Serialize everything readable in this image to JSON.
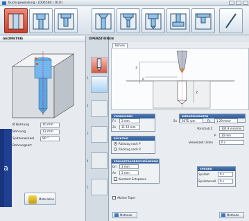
{
  "window": {
    "title": "Buchsgewindung - [D04580 / D10]"
  },
  "toolbar": {
    "buttons": [
      {
        "name": "through-hole-tool",
        "active": true
      },
      {
        "name": "stepped-hole-tool",
        "active": false
      },
      {
        "name": "counterbore-tool",
        "active": false
      },
      {
        "name": "countersink-tool",
        "active": false
      },
      {
        "name": "stepped-countersink-tool",
        "active": false
      },
      {
        "name": "tapered-counterbore-tool",
        "active": false
      },
      {
        "name": "t-slot-tool",
        "active": false
      },
      {
        "name": "spot-face-tool",
        "active": false
      },
      {
        "name": "diagonal-tool",
        "active": false
      }
    ]
  },
  "left": {
    "header": "GEOMETRIE",
    "fields": [
      {
        "label": "Ø Bohrung",
        "value": "10 mm"
      },
      {
        "label": "Bohrung",
        "value": "12 mm"
      },
      {
        "label": "Spitzenwinkel",
        "value": "90 °"
      },
      {
        "label": "Bohrungsart",
        "value": ""
      }
    ],
    "overlay_text": "a",
    "material_button": "Materialien"
  },
  "operations": {
    "header": "OPERATIONEN",
    "numbers": [
      "1",
      "2",
      "3",
      "4",
      "5"
    ]
  },
  "main": {
    "tab": "Bohren",
    "vorbohren": {
      "header": "VORBOHREN",
      "rows": [
        {
          "label": "Fn",
          "value": "2 mm"
        },
        {
          "label": "Zn",
          "value": "31.12 mm"
        }
      ]
    },
    "rueckzug": {
      "header": "RÜCKZUG",
      "options": [
        "Rückzug nach P",
        "Rückzug nach R"
      ],
      "selected": 0
    },
    "spanabtrag": {
      "header": "SPANABTRAGBESCHRÄNKUNG",
      "rows": [
        {
          "label": "Dn",
          "value": "3 mm"
        },
        {
          "label": "An",
          "value": "3 mm"
        }
      ],
      "check_label": "Konstant Entspanen"
    },
    "werkzeug": {
      "header": "WERKZEUGDATEN",
      "rows": [
        {
          "label": "Sn",
          "value": "3075 rpm"
        },
        {
          "label": "Fz",
          "value": "1.29 mm/r"
        }
      ],
      "extra": [
        {
          "label": "Vorschub Z",
          "value": "304.9 mm/min"
        },
        {
          "label": "P",
          "value": "10 mm"
        },
        {
          "label": "Verweilzeit Unten",
          "value": "0 s"
        }
      ]
    },
    "sprung": {
      "header": "SPRUNG",
      "rows": [
        {
          "label": "Spülzeit",
          "value": "0 s"
        },
        {
          "label": "Spülintervall",
          "value": "0 s"
        }
      ]
    },
    "footer_check": "Aktiver Taper",
    "buttons": [
      "Methode",
      "Methode"
    ]
  }
}
